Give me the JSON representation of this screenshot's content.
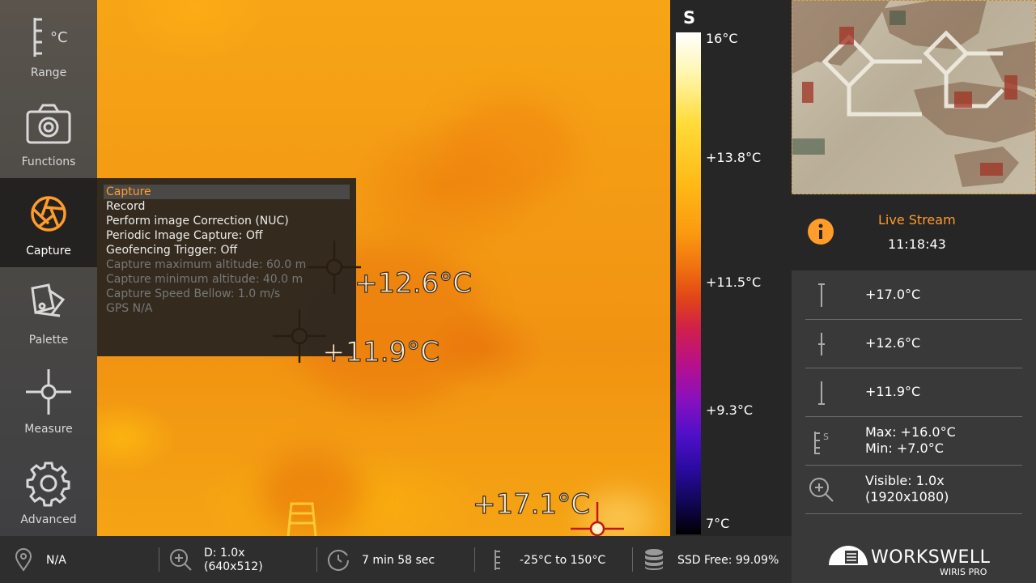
{
  "sidebar": {
    "items": [
      {
        "label": "Range",
        "icon": "thermometer-scale-icon"
      },
      {
        "label": "Functions",
        "icon": "camera-icon"
      },
      {
        "label": "Capture",
        "icon": "aperture-icon",
        "active": true
      },
      {
        "label": "Palette",
        "icon": "palette-swatch-icon"
      },
      {
        "label": "Measure",
        "icon": "crosshair-icon"
      },
      {
        "label": "Advanced",
        "icon": "gear-icon"
      }
    ],
    "range_unit": "°C"
  },
  "capture_menu": {
    "items": [
      {
        "label": "Capture",
        "state": "selected"
      },
      {
        "label": "Record",
        "state": "enabled"
      },
      {
        "label": "Perform image Correction (NUC)",
        "state": "enabled"
      },
      {
        "label": "Periodic Image Capture: Off",
        "state": "enabled"
      },
      {
        "label": "Geofencing Trigger: Off",
        "state": "enabled"
      },
      {
        "label": "Capture maximum altitude: 60.0 m",
        "state": "disabled"
      },
      {
        "label": "Capture minimum altitude: 40.0 m",
        "state": "disabled"
      },
      {
        "label": "Capture Speed Bellow: 1.0 m/s",
        "state": "disabled"
      },
      {
        "label": "GPS N/A",
        "state": "disabled"
      }
    ]
  },
  "thermal_view": {
    "measurements": [
      {
        "label": "+12.6°C",
        "kind": "center"
      },
      {
        "label": "+11.9°C",
        "kind": "min"
      },
      {
        "label": "+17.1°C",
        "kind": "max"
      }
    ]
  },
  "palette": {
    "letter": "S",
    "ticks": [
      "16°C",
      "+13.8°C",
      "+11.5°C",
      "+9.3°C",
      "7°C"
    ]
  },
  "right_panel": {
    "live_title": "Live Stream",
    "live_time": "11:18:43",
    "rows": [
      {
        "icon": "max-temp-icon",
        "lines": [
          "+17.0°C"
        ]
      },
      {
        "icon": "center-temp-icon",
        "lines": [
          "+12.6°C"
        ]
      },
      {
        "icon": "min-temp-icon",
        "lines": [
          "+11.9°C"
        ]
      },
      {
        "icon": "range-scale-icon",
        "lines": [
          "Max: +16.0°C",
          "Min: +7.0°C"
        ],
        "icon_letter": "S"
      },
      {
        "icon": "zoom-icon",
        "lines": [
          "Visible: 1.0x",
          "(1920x1080)"
        ]
      }
    ]
  },
  "statusbar": {
    "gps": "N/A",
    "zoom_line1": "D: 1.0x",
    "zoom_line2": "(640x512)",
    "recording_time": "7 min 58 sec",
    "temp_range": "-25°C to 150°C",
    "ssd": "SSD Free: 99.09%"
  },
  "brand": {
    "name": "WORKSWELL",
    "product": "WIRIS PRO"
  },
  "colors": {
    "accent": "#ff9c2a",
    "panel": "#393939",
    "dark": "#262626"
  }
}
